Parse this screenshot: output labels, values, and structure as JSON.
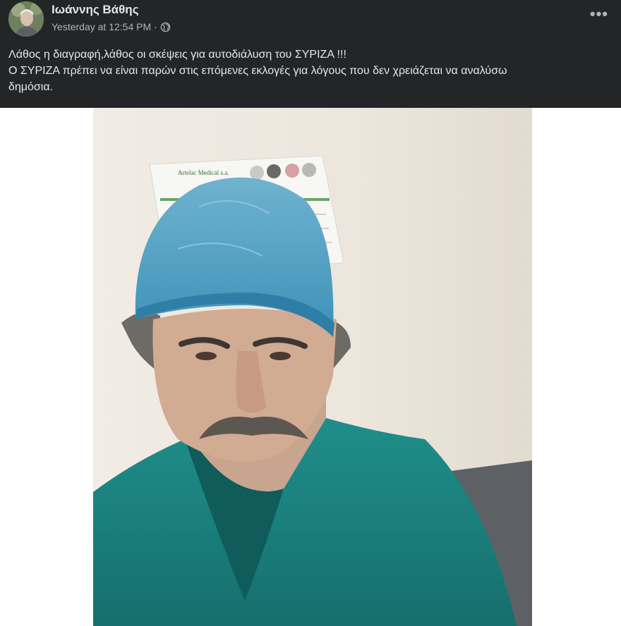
{
  "post": {
    "author": "Ιωάννης Βάθης",
    "timestamp": "Yesterday at 12:54 PM",
    "separator": "·",
    "privacy_icon": "globe-icon",
    "more_label": "•••",
    "text_lines": [
      "Λάθος η διαγραφή,λάθος οι σκέψεις για  αυτοδιάλυση του ΣΥΡΙΖΑ !!!",
      "Ο ΣΥΡΙΖΑ πρέπει να είναι παρών στις επόμενες εκλογές για λόγους που δεν χρειάζεται να αναλύσω",
      "δημόσια."
    ]
  },
  "poster": {
    "brand": "Artelac Medical s.a."
  },
  "colors": {
    "header_bg": "#242526",
    "text_primary": "#e4e6eb",
    "text_secondary": "#b0b3b8"
  }
}
